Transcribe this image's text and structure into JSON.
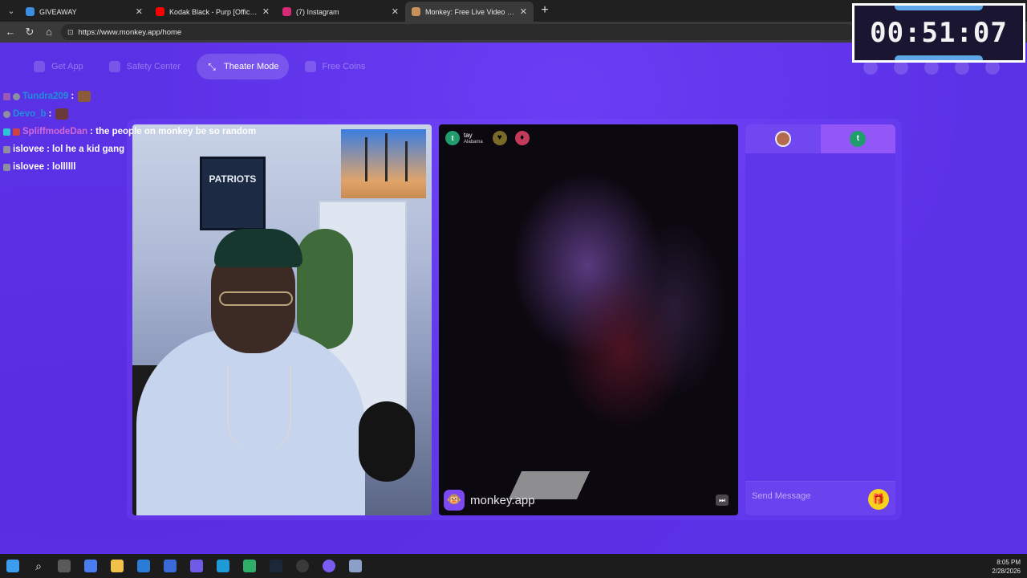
{
  "browser": {
    "tabs": [
      {
        "label": "GIVEAWAY",
        "active": false,
        "favicon_color": "#3a8de0"
      },
      {
        "label": "Kodak Black - Purp [Official Audio]",
        "active": false,
        "favicon_color": "#ff0000"
      },
      {
        "label": "(7) Instagram",
        "active": false,
        "favicon_color": "#d62976"
      },
      {
        "label": "Monkey: Free Live Video Chat",
        "active": true,
        "favicon_color": "#c8915a"
      }
    ],
    "url": "https://www.monkey.app/home"
  },
  "topnav": {
    "items": [
      {
        "label": "Get App",
        "active": false
      },
      {
        "label": "Safety Center",
        "active": false
      },
      {
        "label": "Theater Mode",
        "active": true
      },
      {
        "label": "Free Coins",
        "active": false
      }
    ]
  },
  "chat": {
    "messages": [
      {
        "user": "Tundra209",
        "user_color": "#1f8fd9",
        "text": "",
        "has_emote": true,
        "badge_color": "#9b59b6"
      },
      {
        "user": "Devo_b",
        "user_color": "#1f8fd9",
        "text": "",
        "has_emote": true,
        "badge_color": "#8e8ea0"
      },
      {
        "user": "SpliffmodeDan",
        "user_color": "#d16ad6",
        "text": "the people on monkey be so random",
        "has_emote": false,
        "badge_color": "#2ec4d6"
      },
      {
        "user": "islovee",
        "user_color": "#ffffff",
        "text": "lol he a kid gang",
        "has_emote": false,
        "badge_color": "#8e8ea0"
      },
      {
        "user": "islovee",
        "user_color": "#ffffff",
        "text": "lollllll",
        "has_emote": false,
        "badge_color": "#8e8ea0"
      }
    ]
  },
  "peer": {
    "name": "tay",
    "location": "Alabama",
    "avatar_letter": "t"
  },
  "brand": {
    "name": "monkey.app"
  },
  "sidepanel": {
    "avatar_letter": "t",
    "input_placeholder": "Send Message"
  },
  "timer": {
    "value": "00:51:07"
  },
  "clock": {
    "time": "8:05 PM",
    "date": "2/28/2026"
  }
}
